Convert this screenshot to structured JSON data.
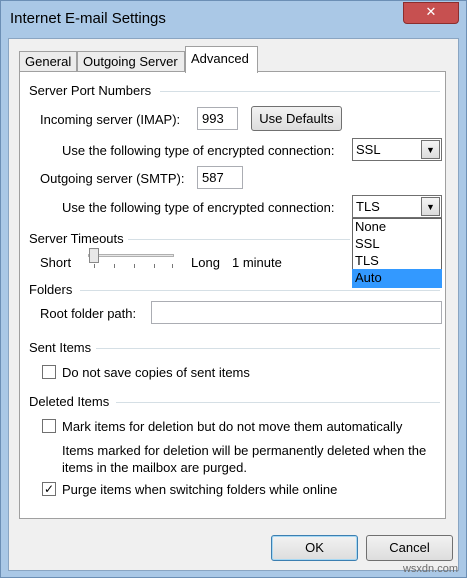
{
  "window": {
    "title": "Internet E-mail Settings",
    "close_glyph": "✕"
  },
  "tabs": [
    {
      "label": "General",
      "active": false
    },
    {
      "label": "Outgoing Server",
      "active": false
    },
    {
      "label": "Advanced",
      "active": true
    }
  ],
  "server_ports": {
    "heading": "Server Port Numbers",
    "incoming_label": "Incoming server (IMAP):",
    "incoming_value": "993",
    "use_defaults_label": "Use Defaults",
    "incoming_enc_label": "Use the following type of encrypted connection:",
    "incoming_enc_value": "SSL",
    "outgoing_label": "Outgoing server (SMTP):",
    "outgoing_value": "587",
    "outgoing_enc_label": "Use the following type of encrypted connection:",
    "outgoing_enc_value": "TLS",
    "enc_options": [
      "None",
      "SSL",
      "TLS",
      "Auto"
    ],
    "highlighted_option": "Auto"
  },
  "timeouts": {
    "heading": "Server Timeouts",
    "short_label": "Short",
    "long_label": "Long",
    "value_label": "1 minute",
    "slider_position": 0.05
  },
  "folders": {
    "heading": "Folders",
    "root_label": "Root folder path:",
    "root_value": ""
  },
  "sent_items": {
    "heading": "Sent Items",
    "no_save_label": "Do not save copies of sent items",
    "no_save_checked": false
  },
  "deleted_items": {
    "heading": "Deleted Items",
    "mark_label": "Mark items for deletion but do not move them automatically",
    "mark_checked": false,
    "info_line1": "Items marked for deletion will be permanently deleted when the",
    "info_line2": "items in the mailbox are purged.",
    "purge_label": "Purge items when switching folders while online",
    "purge_checked": true
  },
  "buttons": {
    "ok": "OK",
    "cancel": "Cancel"
  },
  "watermark": "wsxdn.com",
  "colors": {
    "frame": "#aac8e6",
    "highlight": "#3399ff"
  }
}
